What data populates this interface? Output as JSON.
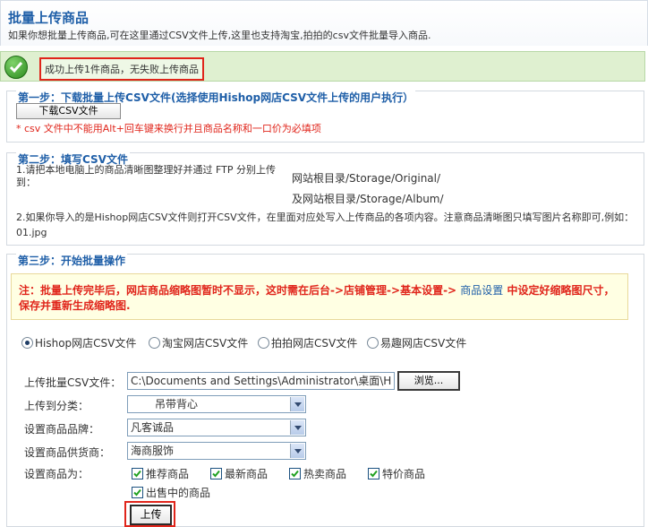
{
  "header": {
    "title": "批量上传商品",
    "description": "如果你想批量上传商品,可在这里通过CSV文件上传,这里也支持淘宝,拍拍的csv文件批量导入商品."
  },
  "result": {
    "message": "成功上传1件商品，无失败上传商品"
  },
  "step1": {
    "title": "第一步：下载批量上传CSV文件(选择使用Hishop网店CSV文件上传的用户执行）",
    "download_label": "下载CSV文件",
    "note": "* csv 文件中不能用Alt+回车键来换行并且商品名称和一口价为必填项"
  },
  "step2": {
    "title": "第二步：填写CSV文件",
    "line1": "1.请把本地电脑上的商品清晰图整理好并通过  FTP 分别上传到：",
    "path1": "网站根目录/Storage/Original/",
    "path2": "及网站根目录/Storage/Album/",
    "line2": "2.如果你导入的是Hishop网店CSV文件则打开CSV文件，在里面对应处写入上传商品的各项内容。注意商品清晰图只填写图片名称即可,例如：01.jpg"
  },
  "step3": {
    "title": "第三步：开始批量操作",
    "notice_pre": "注：批量上传完毕后，网店商品缩略图暂时不显示，这时需在后台->店铺管理->基本设置-> ",
    "notice_link": "商品设置",
    "notice_post": " 中设定好缩略图尺寸，保存并重新生成缩略图.",
    "radios": [
      "Hishop网店CSV文件",
      "淘宝网店CSV文件",
      "拍拍网店CSV文件",
      "易趣网店CSV文件"
    ],
    "selected_radio": "Hishop网店CSV文件",
    "file_label": "上传批量CSV文件：",
    "file_value": "C:\\Documents and Settings\\Administrator\\桌面\\HiS",
    "browse_label": "浏览...",
    "category_label": "上传到分类：",
    "category_value": "吊带背心",
    "brand_label": "设置商品品牌：",
    "brand_value": "凡客诚品",
    "supplier_label": "设置商品供货商：",
    "supplier_value": "海商服饰",
    "flags_label": "设置商品为：",
    "flags": [
      "推荐商品",
      "最新商品",
      "热卖商品",
      "特价商品",
      "出售中的商品"
    ],
    "upload_label": "上传"
  },
  "colors": {
    "accent": "#1f5fa8",
    "error": "#e0251b",
    "success_bg": "#dff0d0",
    "notice_bg": "#ffffe3"
  }
}
